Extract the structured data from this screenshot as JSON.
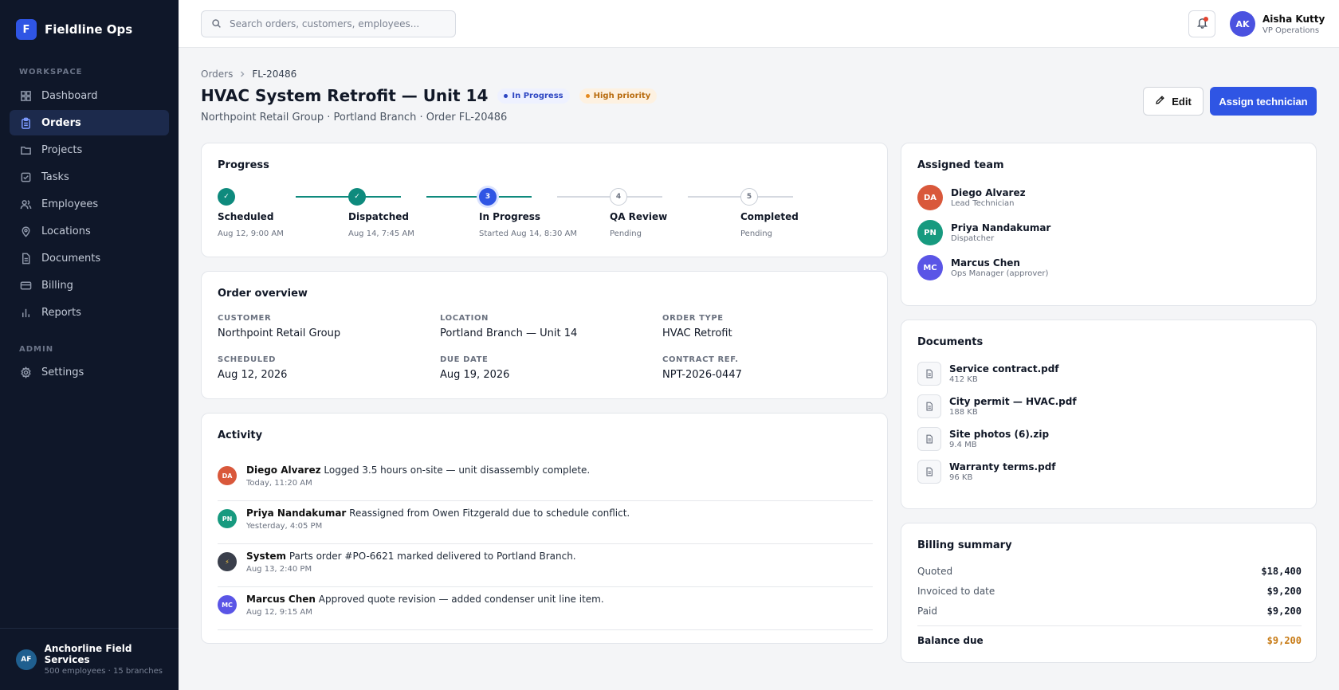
{
  "brand": {
    "logo": "F",
    "name": "Fieldline Ops"
  },
  "sidebar": {
    "workspace_label": "WORKSPACE",
    "items": [
      {
        "label": "Dashboard",
        "icon": "grid-icon"
      },
      {
        "label": "Orders",
        "icon": "clipboard-icon"
      },
      {
        "label": "Projects",
        "icon": "folder-icon"
      },
      {
        "label": "Tasks",
        "icon": "checkbox-icon"
      },
      {
        "label": "Employees",
        "icon": "users-icon"
      },
      {
        "label": "Locations",
        "icon": "map-pin-icon"
      },
      {
        "label": "Documents",
        "icon": "document-icon"
      },
      {
        "label": "Billing",
        "icon": "credit-card-icon"
      },
      {
        "label": "Reports",
        "icon": "bar-chart-icon"
      }
    ],
    "admin_label": "ADMIN",
    "admin_items": [
      {
        "label": "Settings",
        "icon": "gear-icon"
      }
    ],
    "org": {
      "initials": "AF",
      "name": "Anchorline Field Services",
      "sub": "500 employees · 15 branches"
    }
  },
  "header": {
    "search_placeholder": "Search orders, customers, employees...",
    "user": {
      "initials": "AK",
      "name": "Aisha Kutty",
      "role": "VP Operations"
    }
  },
  "page": {
    "breadcrumb": [
      "Orders",
      "FL-20486"
    ],
    "title": "HVAC System Retrofit — Unit 14",
    "status_badge": "In Progress",
    "priority_badge": "High priority",
    "subtitle": "Northpoint Retail Group · Portland Branch · Order FL-20486",
    "edit_label": "Edit",
    "assign_label": "Assign technician"
  },
  "progress": {
    "title": "Progress",
    "steps": [
      {
        "num": "✓",
        "label": "Scheduled",
        "sub": "Aug 12, 9:00 AM",
        "state": "done"
      },
      {
        "num": "✓",
        "label": "Dispatched",
        "sub": "Aug 14, 7:45 AM",
        "state": "done"
      },
      {
        "num": "3",
        "label": "In Progress",
        "sub": "Started Aug 14, 8:30 AM",
        "state": "current"
      },
      {
        "num": "4",
        "label": "QA Review",
        "sub": "Pending",
        "state": "pending"
      },
      {
        "num": "5",
        "label": "Completed",
        "sub": "Pending",
        "state": "pending"
      }
    ]
  },
  "overview": {
    "title": "Order overview",
    "fields": [
      {
        "label": "CUSTOMER",
        "value": "Northpoint Retail Group"
      },
      {
        "label": "LOCATION",
        "value": "Portland Branch — Unit 14"
      },
      {
        "label": "ORDER TYPE",
        "value": "HVAC Retrofit"
      },
      {
        "label": "SCHEDULED",
        "value": "Aug 12, 2026"
      },
      {
        "label": "DUE DATE",
        "value": "Aug 19, 2026"
      },
      {
        "label": "CONTRACT REF.",
        "value": "NPT-2026-0447"
      }
    ]
  },
  "activity": {
    "title": "Activity",
    "items": [
      {
        "initials": "DA",
        "color": "#d9583b",
        "name": "Diego Alvarez",
        "text": "Logged 3.5 hours on-site — unit disassembly complete.",
        "time": "Today, 11:20 AM"
      },
      {
        "initials": "PN",
        "color": "#179a7f",
        "name": "Priya Nandakumar",
        "text": "Reassigned from Owen Fitzgerald due to schedule conflict.",
        "time": "Yesterday, 4:05 PM"
      },
      {
        "initials": "⚡",
        "color": "#3a3f4b",
        "name": "System",
        "text": "Parts order #PO-6621 marked delivered to Portland Branch.",
        "time": "Aug 13, 2:40 PM"
      },
      {
        "initials": "MC",
        "color": "#5a55e6",
        "name": "Marcus Chen",
        "text": "Approved quote revision — added condenser unit line item.",
        "time": "Aug 12, 9:15 AM"
      }
    ]
  },
  "team": {
    "title": "Assigned team",
    "members": [
      {
        "initials": "DA",
        "color": "#d9583b",
        "name": "Diego Alvarez",
        "role": "Lead Technician"
      },
      {
        "initials": "PN",
        "color": "#179a7f",
        "name": "Priya Nandakumar",
        "role": "Dispatcher"
      },
      {
        "initials": "MC",
        "color": "#5a55e6",
        "name": "Marcus Chen",
        "role": "Ops Manager (approver)"
      }
    ]
  },
  "documents": {
    "title": "Documents",
    "files": [
      {
        "name": "Service contract.pdf",
        "size": "412 KB"
      },
      {
        "name": "City permit — HVAC.pdf",
        "size": "188 KB"
      },
      {
        "name": "Site photos (6).zip",
        "size": "9.4 MB"
      },
      {
        "name": "Warranty terms.pdf",
        "size": "96 KB"
      }
    ]
  },
  "billing": {
    "title": "Billing summary",
    "rows": [
      {
        "label": "Quoted",
        "value": "$18,400"
      },
      {
        "label": "Invoiced to date",
        "value": "$9,200"
      },
      {
        "label": "Paid",
        "value": "$9,200"
      }
    ],
    "total": {
      "label": "Balance due",
      "value": "$9,200"
    }
  },
  "colors": {
    "accent": "#2f55e4",
    "sidebar_bg": "#0f1729",
    "done": "#0e8a7d",
    "warning": "#c77a14"
  }
}
